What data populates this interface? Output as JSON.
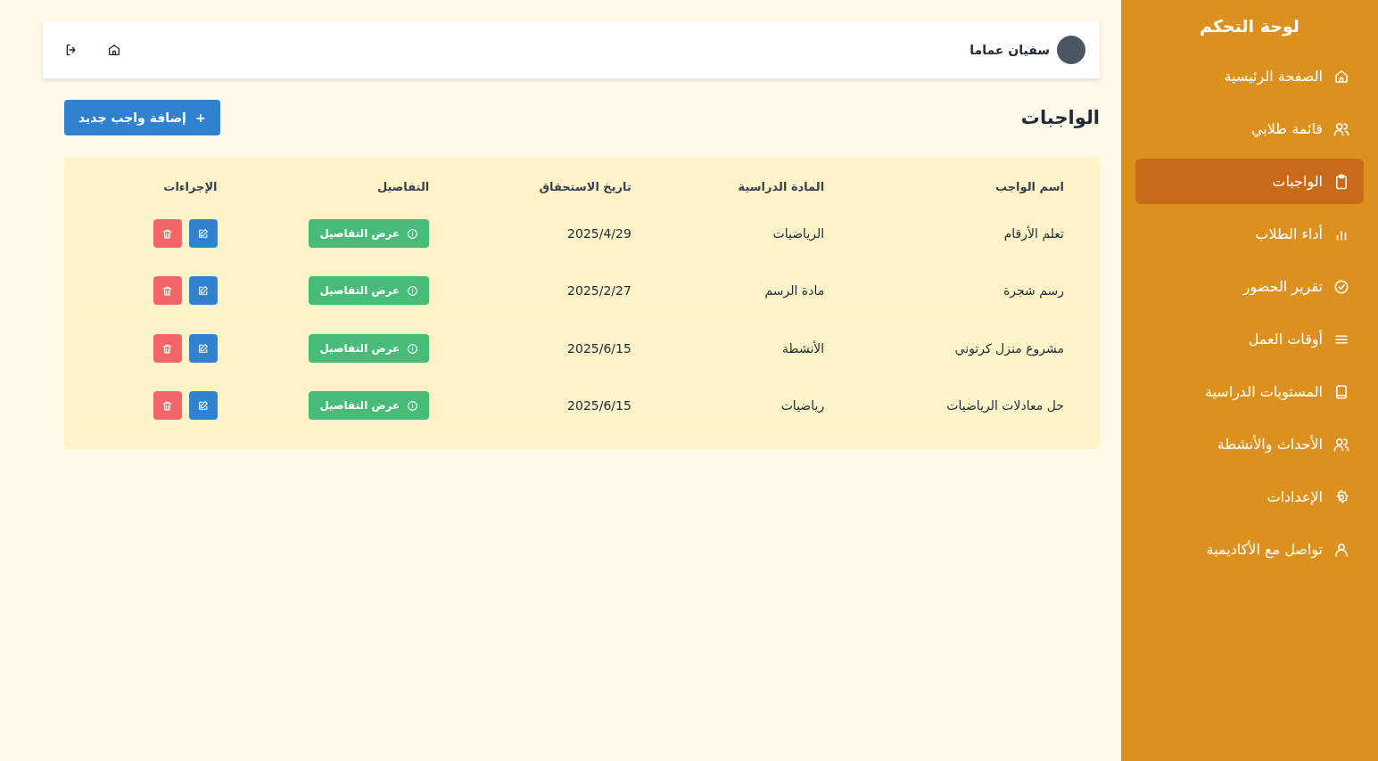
{
  "sidebar": {
    "title": "لوحة التحكم",
    "items": [
      {
        "label": "الصفحة الرئيسية",
        "selected": false
      },
      {
        "label": "قائمة طلابي",
        "selected": false
      },
      {
        "label": "الواجبات",
        "selected": true
      },
      {
        "label": "أداء الطلاب",
        "selected": false
      },
      {
        "label": "تقرير الحضور",
        "selected": false
      },
      {
        "label": "أوقات العمل",
        "selected": false
      },
      {
        "label": "المستويات الدراسية",
        "selected": false
      },
      {
        "label": "الأحداث والأنشطة",
        "selected": false
      },
      {
        "label": "الإعدادات",
        "selected": false
      },
      {
        "label": "تواصل مع الأكاديمية",
        "selected": false
      }
    ]
  },
  "header": {
    "user_name": "سفيان عماما"
  },
  "page": {
    "title": "الواجبات",
    "add_button": "إضافة واجب جديد",
    "add_icon": "+"
  },
  "table": {
    "columns": [
      "اسم الواجب",
      "المادة الدراسية",
      "تاريخ الاستحقاق",
      "التفاصيل",
      "الإجراءات"
    ],
    "rows": [
      {
        "name": "تعلم الأرقام",
        "subject": "الرياضيات",
        "due": "2025/4/29",
        "details": "عرض التفاصيل"
      },
      {
        "name": "رسم شجرة",
        "subject": "مادة الرسم",
        "due": "2025/2/27",
        "details": "عرض التفاصيل"
      },
      {
        "name": "مشروع منزل كرتوني",
        "subject": "الأنشطة",
        "due": "2025/6/15",
        "details": "عرض التفاصيل"
      },
      {
        "name": "حل معادلات الرياضيات",
        "subject": "رياضيات",
        "due": "2025/6/15",
        "details": "عرض التفاصيل"
      }
    ]
  }
}
